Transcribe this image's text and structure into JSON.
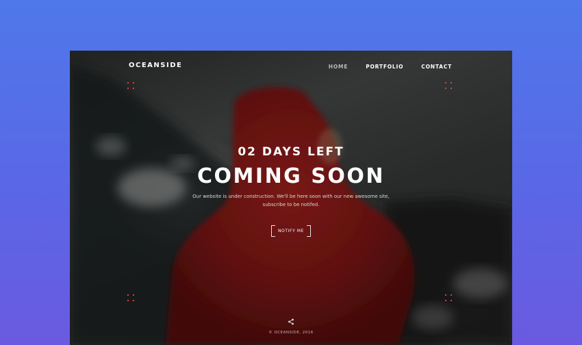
{
  "brand": "OCEANSIDE",
  "nav": [
    {
      "label": "HOME",
      "active": true
    },
    {
      "label": "PORTFOLIO",
      "active": false
    },
    {
      "label": "CONTACT",
      "active": false
    }
  ],
  "hero": {
    "countdown": "02 DAYS LEFT",
    "title": "COMING SOON",
    "description_line1": "Our website is under construction. We'll be here soon with our new awesome site,",
    "description_line2": "subscribe to be notifed.",
    "cta_label": "NOTIFY ME"
  },
  "footer": {
    "copyright": "© OCEANSIDE, 2016"
  },
  "icons": {
    "share": "share-icon"
  },
  "colors": {
    "background_top": "#4f78ea",
    "background_bottom": "#6a5ae0",
    "jacket_red": "#8e1b1b",
    "corner_accent": "#e0423a"
  }
}
